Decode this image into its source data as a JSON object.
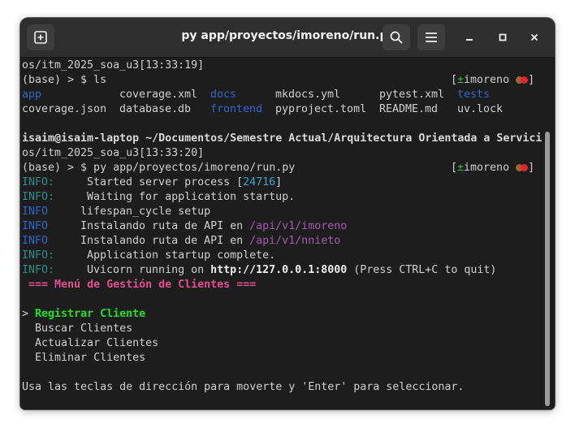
{
  "window": {
    "title": "py app/proyectos/imoreno/run.py"
  },
  "icons": {
    "new_tab": "new-tab-icon",
    "search": "search-icon",
    "menu": "hamburger-menu-icon",
    "minimize": "minimize-icon",
    "maximize": "maximize-icon",
    "close": "close-icon"
  },
  "terminal": {
    "l1": "os/itm_2025_soa_u3[13:33:19]",
    "l2_cmd": "(base) > $ ls",
    "prompt_user": "imoreno",
    "prompt_plus": "±",
    "bracket_open": "[",
    "bracket_close": "]",
    "ls": {
      "r1": [
        "app",
        "coverage.xml",
        "docs",
        "mkdocs.yml",
        "pytest.xml",
        "tests"
      ],
      "r2": [
        "coverage.json",
        "database.db",
        "frontend",
        "pyproject.toml",
        "README.md",
        "uv.lock"
      ]
    },
    "path_line": "isaim@isaim-laptop ~/Documentos/Semestre Actual/Arquitectura Orientada a Servici",
    "l6": "os/itm_2025_soa_u3[13:33:20]",
    "l7_cmd": "(base) > $ py app/proyectos/imoreno/run.py",
    "log": {
      "info": "INFO:",
      "info_plain": "INFO",
      "started": "Started server process [",
      "pid": "24716",
      "started_end": "]",
      "waiting": "Waiting for application startup.",
      "lifespan": "lifespan_cycle setup",
      "route_prefix": "Instalando ruta de API en ",
      "route1": "/api/v1/imoreno",
      "route2": "/api/v1/nnieto",
      "complete": "Application startup complete.",
      "uvicorn_pre": "Uvicorn running on ",
      "uvicorn_url": "http://127.0.0.1:8000",
      "uvicorn_post": " (Press CTRL+C to quit)"
    },
    "menu_title": "=== Menú de Gestión de Clientes ===",
    "cursor": ">",
    "menu_items": [
      "Registrar Cliente",
      "Buscar Clientes",
      "Actualizar Clientes",
      "Eliminar Clientes"
    ],
    "hint": "Usa las teclas de dirección para moverte y 'Enter' para seleccionar."
  },
  "colors": {
    "status_dot_1": "#a0613a",
    "status_dot_2": "#e0252b"
  }
}
